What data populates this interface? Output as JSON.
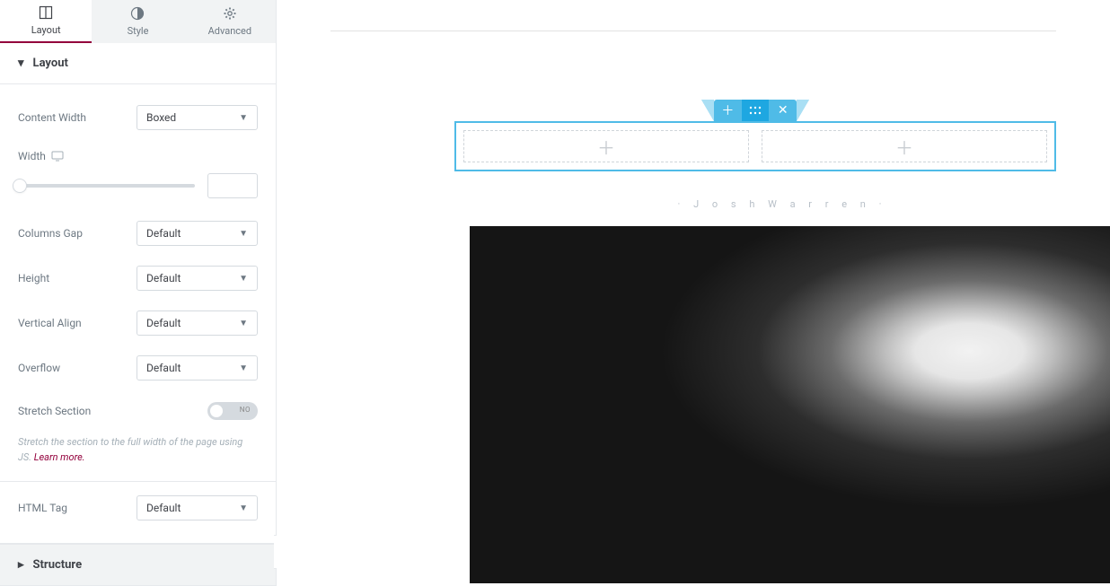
{
  "tabs": {
    "layout": "Layout",
    "style": "Style",
    "advanced": "Advanced"
  },
  "panels": {
    "layout_title": "Layout",
    "structure_title": "Structure"
  },
  "fields": {
    "content_width": {
      "label": "Content Width",
      "value": "Boxed"
    },
    "width": {
      "label": "Width",
      "value": ""
    },
    "columns_gap": {
      "label": "Columns Gap",
      "value": "Default"
    },
    "height": {
      "label": "Height",
      "value": "Default"
    },
    "vertical_align": {
      "label": "Vertical Align",
      "value": "Default"
    },
    "overflow": {
      "label": "Overflow",
      "value": "Default"
    },
    "stretch_section": {
      "label": "Stretch Section",
      "state": "NO"
    },
    "stretch_help": "Stretch the section to the full width of the page using JS. ",
    "stretch_help_link": "Learn more.",
    "html_tag": {
      "label": "HTML Tag",
      "value": "Default"
    }
  },
  "canvas": {
    "caption": "· J o s h   W a r r e n ·"
  }
}
